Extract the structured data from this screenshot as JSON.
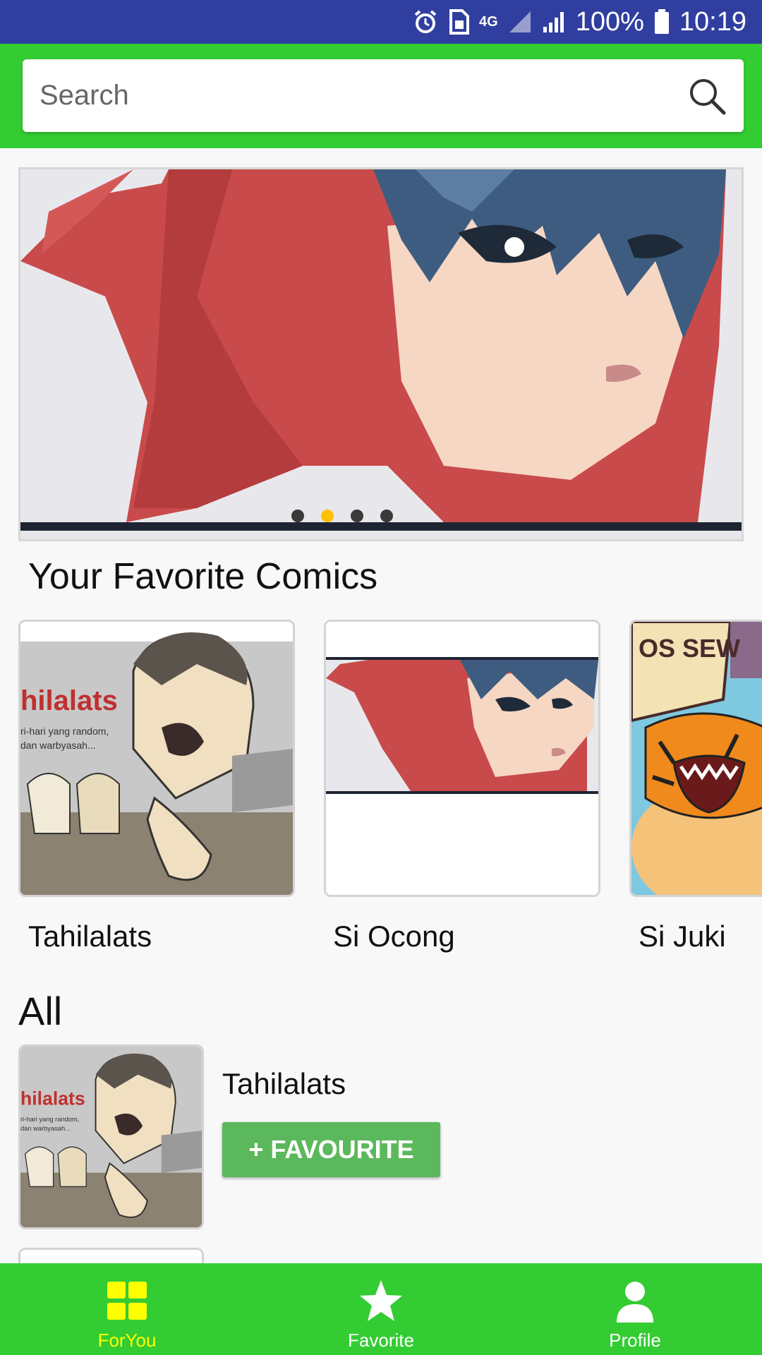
{
  "status_bar": {
    "battery": "100%",
    "time": "10:19",
    "network": "4G",
    "icons": [
      "alarm-icon",
      "sim-icon",
      "network-4g-icon",
      "signal-icon",
      "signal-icon",
      "battery-icon"
    ]
  },
  "search": {
    "placeholder": "Search",
    "value": "",
    "icon": "search-icon"
  },
  "banner": {
    "slide_count": 4,
    "active_index": 1
  },
  "favorites": {
    "title": "Your Favorite Comics",
    "items": [
      {
        "label": "Tahilalats",
        "art_text": "hilalats",
        "art_sub1": "ri-hari yang random,",
        "art_sub2": "dan warbyasah..."
      },
      {
        "label": "Si Ocong"
      },
      {
        "label": "Si Juki",
        "art_text": "OS SEW"
      }
    ]
  },
  "all": {
    "title": "All",
    "items": [
      {
        "title": "Tahilalats",
        "button": "+ FAVOURITE"
      }
    ]
  },
  "nav": {
    "items": [
      {
        "label": "ForYou",
        "icon": "grid-icon",
        "active": true
      },
      {
        "label": "Favorite",
        "icon": "star-icon",
        "active": false
      },
      {
        "label": "Profile",
        "icon": "person-icon",
        "active": false
      }
    ]
  },
  "colors": {
    "status_bar": "#303f9f",
    "primary": "#33cc33",
    "button": "#5cb85c",
    "nav_active": "#ffff00"
  }
}
